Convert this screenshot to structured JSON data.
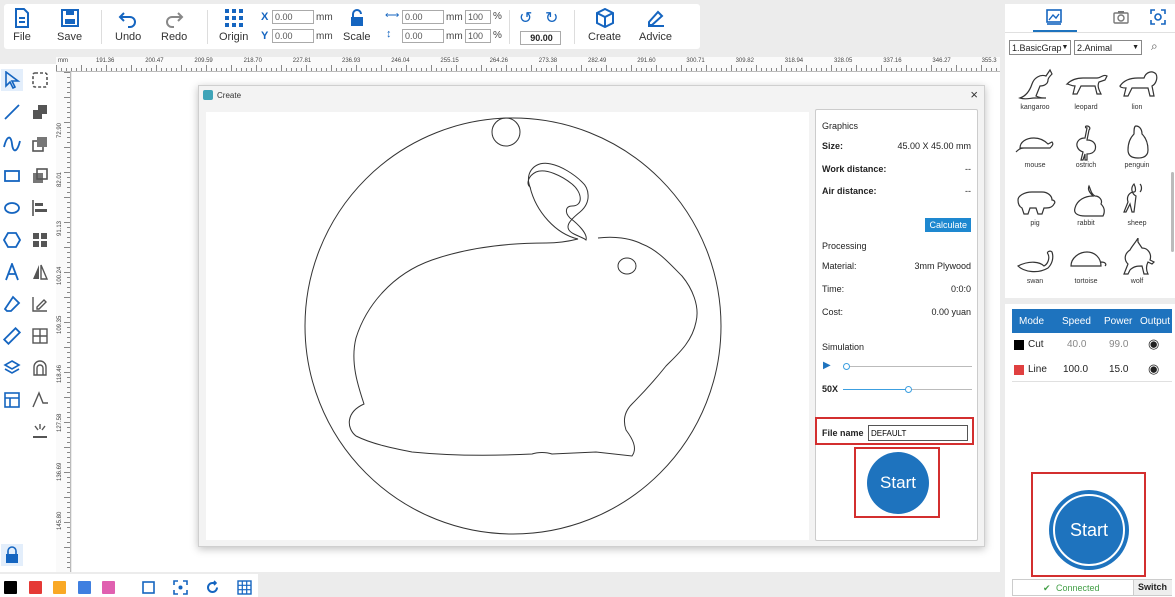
{
  "toolbar": {
    "file": "File",
    "save": "Save",
    "undo": "Undo",
    "redo": "Redo",
    "origin": "Origin",
    "x_label": "X",
    "y_label": "Y",
    "x_value": "0.00",
    "y_value": "0.00",
    "unit_mm": "mm",
    "scale": "Scale",
    "width_value": "0.00",
    "height_value": "0.00",
    "width_pct": "100",
    "height_pct": "100",
    "pct": "%",
    "rotate_value": "90.00",
    "create": "Create",
    "advice": "Advice"
  },
  "ruler": {
    "top_ticks": [
      "mm",
      "191.36",
      "200.47",
      "209.59",
      "218.70",
      "227.81",
      "236.93",
      "246.04",
      "255.15",
      "264.26",
      "273.38",
      "282.49",
      "291.60",
      "300.71",
      "309.82",
      "318.94",
      "328.05",
      "337.16",
      "346.27",
      "355.3"
    ],
    "left_ticks": [
      "72.90",
      "82.01",
      "91.13",
      "100.24",
      "109.35",
      "118.46",
      "127.58",
      "136.69",
      "145.80"
    ]
  },
  "dialog": {
    "title": "Create",
    "close": "×",
    "graphics_heading": "Graphics",
    "size_label": "Size:",
    "size_value": "45.00 X 45.00 mm",
    "work_distance_label": "Work distance:",
    "work_distance_value": "--",
    "air_distance_label": "Air distance:",
    "air_distance_value": "--",
    "calculate": "Calculate",
    "processing_heading": "Processing",
    "material_label": "Material:",
    "material_value": "3mm Plywood",
    "time_label": "Time:",
    "time_value": "0:0:0",
    "cost_label": "Cost:",
    "cost_value": "0.00 yuan",
    "simulation_heading": "Simulation",
    "speed_label": "50X",
    "simulation_progress": 0.0,
    "speed_progress": 0.5,
    "filename_label": "File name",
    "filename_value": "DEFAULT",
    "start": "Start"
  },
  "library": {
    "category1": "1.BasicGrap",
    "category2": "2.Animal",
    "shapes": [
      "kangaroo",
      "leopard",
      "lion",
      "mouse",
      "ostrich",
      "penguin",
      "pig",
      "rabbit",
      "sheep",
      "swan",
      "tortoise",
      "wolf"
    ]
  },
  "layers": {
    "headers": [
      "Mode",
      "Speed",
      "Power",
      "Output"
    ],
    "rows": [
      {
        "color": "#000000",
        "mode": "Cut",
        "speed": "40.0",
        "power": "99.0"
      },
      {
        "color": "#e04040",
        "mode": "Line",
        "speed": "100.0",
        "power": "15.0"
      }
    ]
  },
  "start_main": "Start",
  "status": {
    "connected": "Connected",
    "switch": "Switch"
  },
  "colors": {
    "accent": "#1e73be",
    "highlight": "#d32f2f",
    "connected": "#43a047"
  },
  "swatches": [
    "#000000",
    "#e53935",
    "#f9a825",
    "#3f7fe0",
    "#e060b0"
  ]
}
